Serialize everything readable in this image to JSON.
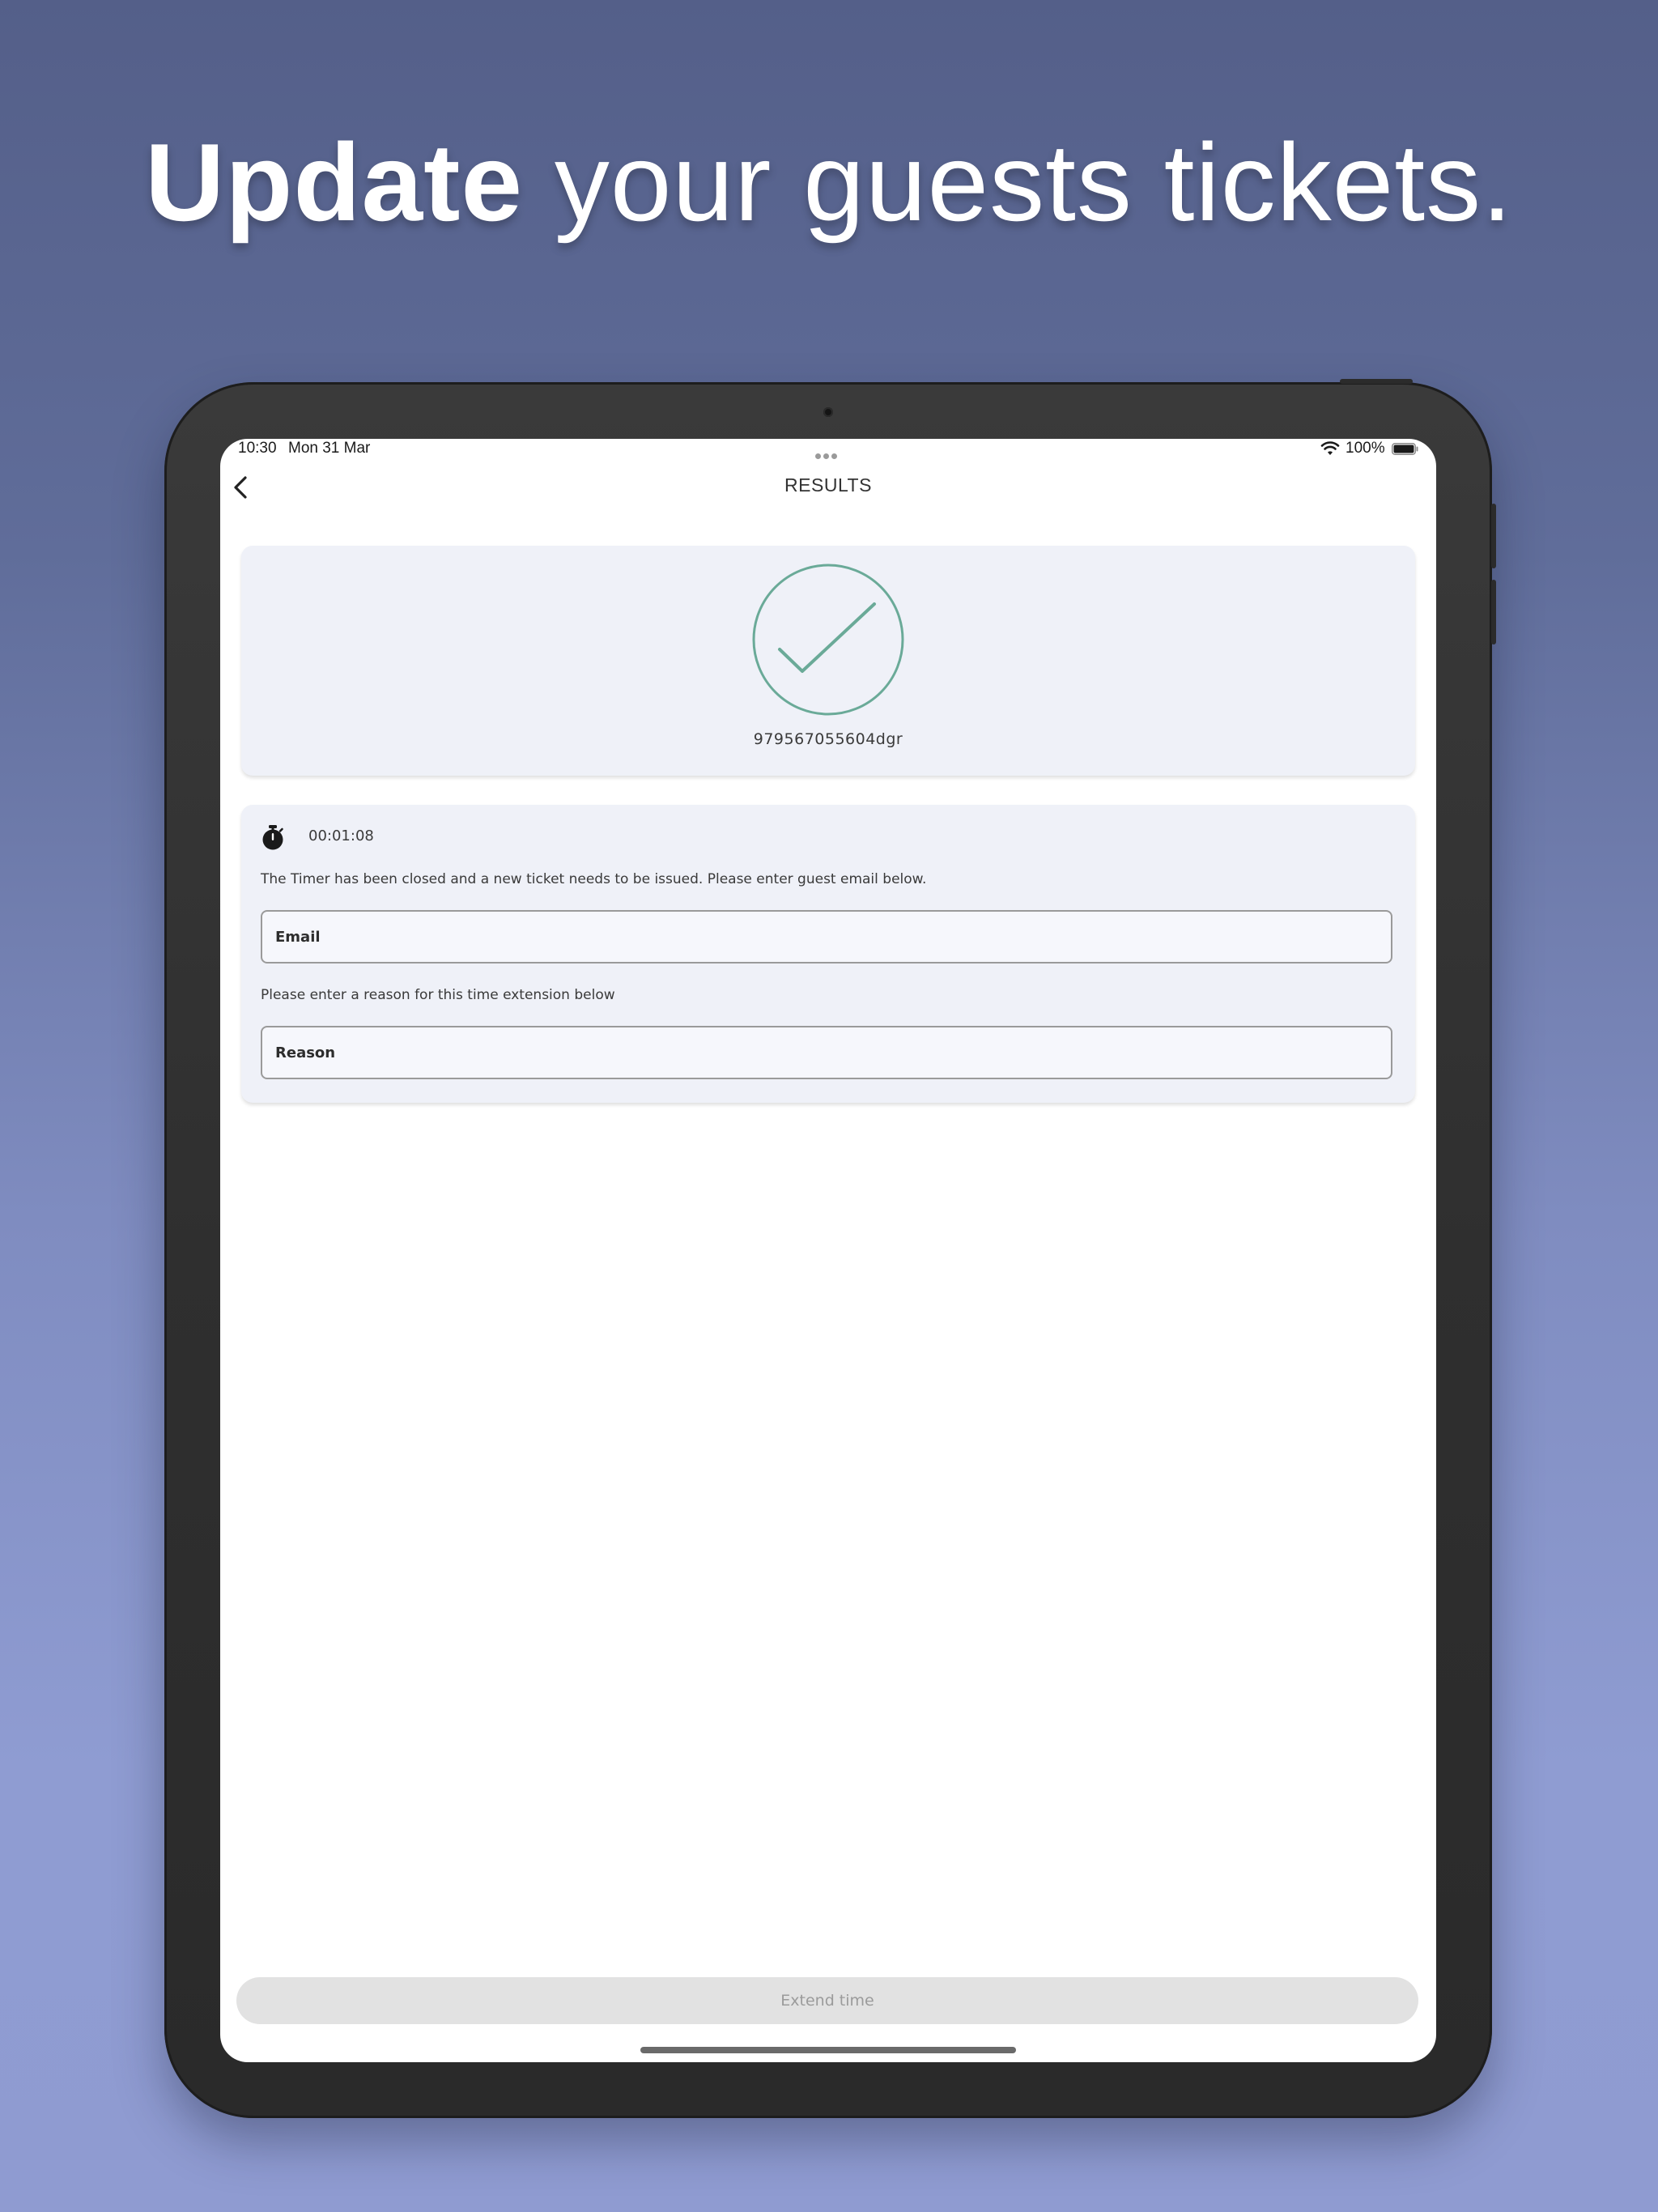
{
  "headline": {
    "strong": "Update",
    "rest": "your guests tickets."
  },
  "status_bar": {
    "time": "10:30",
    "date": "Mon 31 Mar",
    "battery": "100%"
  },
  "nav": {
    "title": "RESULTS"
  },
  "result_card": {
    "status_icon": "check-circle-icon",
    "ticket_id": "979567055604dgr"
  },
  "form_card": {
    "timer_icon": "stopwatch-icon",
    "timer": "00:01:08",
    "message": "The Timer has been closed and a new ticket needs to be issued. Please enter guest email below.",
    "email_placeholder": "Email",
    "reason_prompt": "Please enter a reason for this time extension below",
    "reason_placeholder": "Reason"
  },
  "footer": {
    "extend_button": "Extend time"
  },
  "colors": {
    "background_top": "#545f89",
    "background_bottom": "#8f9bd1",
    "device_frame": "#333333",
    "card_background": "#eff1f8",
    "check_accent": "#6aaa98",
    "disabled_button": "#e2e2e2"
  }
}
